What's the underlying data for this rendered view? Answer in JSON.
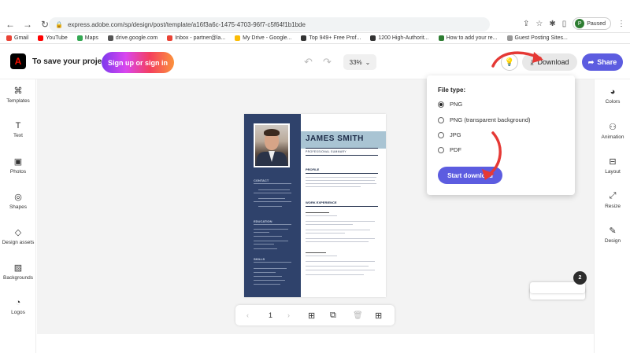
{
  "browser": {
    "url": "express.adobe.com/sp/design/post/template/a16f3a6c-1475-4703-96f7-c5f64f1b1bde",
    "profile_initial": "P",
    "profile_status": "Paused",
    "bookmarks": [
      {
        "label": "Gmail",
        "color": "#ea4335"
      },
      {
        "label": "YouTube",
        "color": "#ff0000"
      },
      {
        "label": "Maps",
        "color": "#34a853"
      },
      {
        "label": "drive.google.com",
        "color": "#555555"
      },
      {
        "label": "Inbox - partner@la...",
        "color": "#ea4335"
      },
      {
        "label": "My Drive - Google...",
        "color": "#fbbc05"
      },
      {
        "label": "Top 949+ Free Prof...",
        "color": "#333333"
      },
      {
        "label": "1200 High-Authorit...",
        "color": "#333333"
      },
      {
        "label": "How to add your re...",
        "color": "#2e7d32"
      },
      {
        "label": "Guest Posting Sites...",
        "color": "#999999"
      }
    ]
  },
  "header": {
    "logo_letter": "A",
    "save_text": "To save your project",
    "signup_label": "Sign up or sign in",
    "zoom": "33%",
    "download_label": "Download",
    "share_label": "Share"
  },
  "left_toolbar": [
    {
      "label": "Templates",
      "icon": "templates-icon"
    },
    {
      "label": "Text",
      "icon": "text-icon"
    },
    {
      "label": "Photos",
      "icon": "photos-icon"
    },
    {
      "label": "Shapes",
      "icon": "shapes-icon"
    },
    {
      "label": "Design assets",
      "icon": "design-assets-icon"
    },
    {
      "label": "Backgrounds",
      "icon": "backgrounds-icon"
    },
    {
      "label": "Logos",
      "icon": "logos-icon"
    }
  ],
  "right_toolbar": [
    {
      "label": "Colors",
      "icon": "colors-icon"
    },
    {
      "label": "Animation",
      "icon": "animation-icon"
    },
    {
      "label": "Layout",
      "icon": "layout-icon"
    },
    {
      "label": "Resize",
      "icon": "resize-icon"
    },
    {
      "label": "Design",
      "icon": "design-icon"
    }
  ],
  "resume": {
    "name": "JAMES SMITH",
    "title": "PROFESSIONAL SUMMARY",
    "profile_heading": "PROFILE",
    "work_heading": "WORK EXPERIENCE",
    "contact_heading": "CONTACT",
    "education_heading": "EDUCATION",
    "skills_heading": "SKILLS"
  },
  "bottom_toolbar": {
    "page_number": "1"
  },
  "pages": {
    "count": "2"
  },
  "download_panel": {
    "file_type_label": "File type:",
    "options": [
      {
        "label": "PNG",
        "selected": true
      },
      {
        "label": "PNG (transparent background)",
        "selected": false
      },
      {
        "label": "JPG",
        "selected": false
      },
      {
        "label": "PDF",
        "selected": false
      }
    ],
    "start_label": "Start download"
  },
  "colors": {
    "accent": "#5c5ce0",
    "annotation_arrow": "#e53935",
    "resume_sidebar": "#2f426b",
    "resume_band": "#a9c4d3"
  }
}
